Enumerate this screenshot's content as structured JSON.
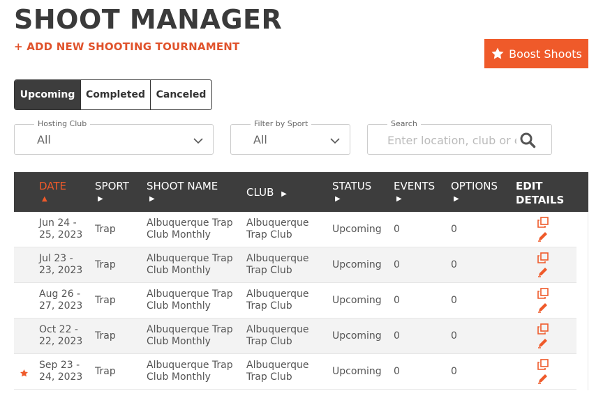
{
  "header": {
    "title": "SHOOT MANAGER",
    "add_link": "+ ADD NEW SHOOTING TOURNAMENT",
    "boost_label": "Boost Shoots"
  },
  "tabs": [
    {
      "label": "Upcoming",
      "active": true
    },
    {
      "label": "Completed",
      "active": false
    },
    {
      "label": "Canceled",
      "active": false
    }
  ],
  "filters": {
    "hosting_club": {
      "label": "Hosting Club",
      "value": "All"
    },
    "sport": {
      "label": "Filter by Sport",
      "value": "All"
    },
    "search": {
      "label": "Search",
      "placeholder": "Enter location, club or event"
    }
  },
  "table": {
    "columns": [
      {
        "label": "DATE",
        "sorted": true
      },
      {
        "label": "SPORT"
      },
      {
        "label": "SHOOT NAME"
      },
      {
        "label": "CLUB"
      },
      {
        "label": "STATUS"
      },
      {
        "label": "EVENTS"
      },
      {
        "label": "OPTIONS"
      },
      {
        "label": "EDIT DETAILS"
      }
    ],
    "rows": [
      {
        "date1": "Jun 24 -",
        "date2": "25, 2023",
        "sport": "Trap",
        "name1": "Albuquerque Trap",
        "name2": "Club Monthly",
        "club1": "Albuquerque",
        "club2": "Trap Club",
        "status": "Upcoming",
        "events": "0",
        "options": "0",
        "featured": false
      },
      {
        "date1": "Jul 23 -",
        "date2": "23, 2023",
        "sport": "Trap",
        "name1": "Albuquerque Trap",
        "name2": "Club Monthly",
        "club1": "Albuquerque",
        "club2": "Trap Club",
        "status": "Upcoming",
        "events": "0",
        "options": "0",
        "featured": false
      },
      {
        "date1": "Aug 26 -",
        "date2": "27, 2023",
        "sport": "Trap",
        "name1": "Albuquerque Trap",
        "name2": "Club Monthly",
        "club1": "Albuquerque",
        "club2": "Trap Club",
        "status": "Upcoming",
        "events": "0",
        "options": "0",
        "featured": false
      },
      {
        "date1": "Oct 22 -",
        "date2": "22, 2023",
        "sport": "Trap",
        "name1": "Albuquerque Trap",
        "name2": "Club Monthly",
        "club1": "Albuquerque",
        "club2": "Trap Club",
        "status": "Upcoming",
        "events": "0",
        "options": "0",
        "featured": false
      },
      {
        "date1": "Sep 23 -",
        "date2": "24, 2023",
        "sport": "Trap",
        "name1": "Albuquerque Trap",
        "name2": "Club Monthly",
        "club1": "Albuquerque",
        "club2": "Trap Club",
        "status": "Upcoming",
        "events": "0",
        "options": "0",
        "featured": true
      }
    ]
  },
  "icons": {
    "boost": "star-icon",
    "dropdown": "chevron-down-icon",
    "search": "search-icon",
    "copy": "copy-icon",
    "edit": "pencil-icon",
    "featured": "star-icon"
  },
  "colors": {
    "accent": "#ef5a2a",
    "header_bg": "#3d3d3d",
    "title": "#3a3a3a"
  }
}
